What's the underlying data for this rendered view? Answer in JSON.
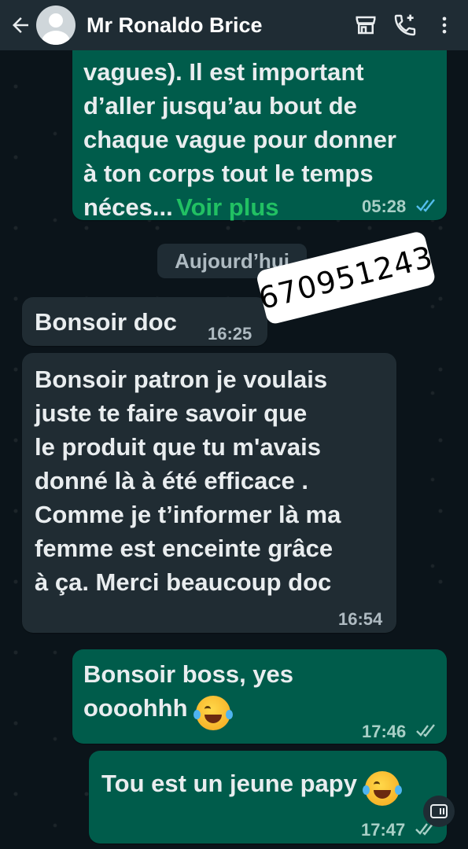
{
  "header": {
    "back_icon": "arrow-left-icon",
    "contact_name": "Mr Ronaldo Brice",
    "store_icon": "storefront-icon",
    "call_icon": "add-call-icon",
    "menu_icon": "more-vert-icon"
  },
  "messages": {
    "m1": {
      "text": "vagues). Il est important\nd’aller jusqu’au bout de\nchaque vague pour donner\nà ton corps tout le temps\nnéces...",
      "more_label": "Voir plus",
      "time": "05:28",
      "status": "read"
    },
    "date_chip": "Aujourd’hui",
    "m2": {
      "text": "Bonsoir doc",
      "time": "16:25"
    },
    "sticker_text": "670951243",
    "m3": {
      "text": "Bonsoir  patron je voulais\njuste te faire savoir que\nle produit que tu m'avais\ndonné là  à été efficace  .\nComme je t’informer là  ma\nfemme est enceinte grâce\nà ça. Merci beaucoup doc",
      "time": "16:54"
    },
    "m4": {
      "text": "Bonsoir boss, yes\noooohhh",
      "time": "17:46",
      "status": "delivered"
    },
    "m5": {
      "text": "Tou est un jeune papy",
      "time": "17:47",
      "status": "delivered"
    }
  },
  "colors": {
    "outgoing": "#005c4b",
    "incoming": "#202c33",
    "header": "#1f2c34",
    "link": "#21c063",
    "read_ticks": "#53bdeb"
  }
}
